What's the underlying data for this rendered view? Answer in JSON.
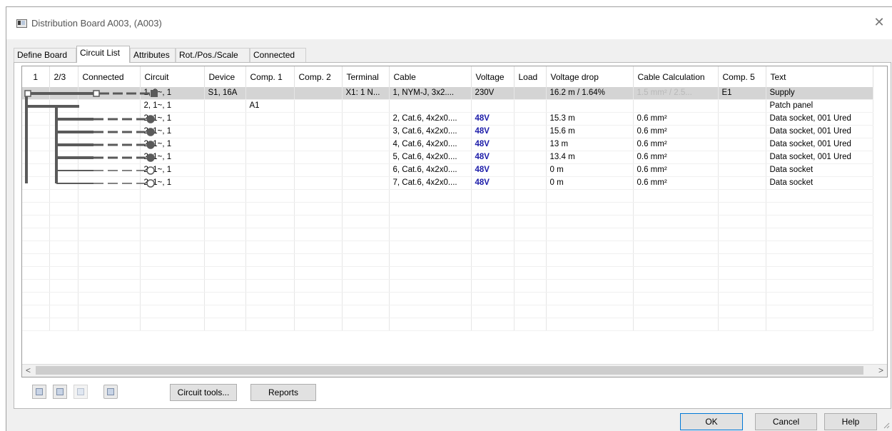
{
  "window": {
    "title": "Distribution Board A003,  (A003)",
    "close_label": "✕"
  },
  "tabs": [
    {
      "label": "Define Board",
      "active": false
    },
    {
      "label": "Circuit List",
      "active": true
    },
    {
      "label": "Attributes",
      "active": false
    },
    {
      "label": "Rot./Pos./Scale",
      "active": false
    },
    {
      "label": "Connected",
      "active": false
    }
  ],
  "grid": {
    "columns": [
      "1",
      "2/3",
      "Connected",
      "Circuit",
      "Device",
      "Comp. 1",
      "Comp. 2",
      "Terminal",
      "Cable",
      "Voltage",
      "Load",
      "Voltage drop",
      "Cable Calculation",
      "Comp. 5",
      "Text"
    ],
    "rows": [
      {
        "circuit": "1, 3~, 1",
        "device": "S1, 16A",
        "comp1": "",
        "comp2": "",
        "terminal": "X1: 1 N...",
        "cable": "1, NYM-J, 3x2....",
        "voltage": "230V",
        "load": "",
        "vdrop": "16.2 m / 1.64%",
        "cablecalc": "1.5 mm² / 2.5...",
        "comp5": "E1",
        "text": "Supply"
      },
      {
        "circuit": "2, 1~, 1",
        "device": "",
        "comp1": "A1",
        "comp2": "",
        "terminal": "",
        "cable": "",
        "voltage": "",
        "load": "",
        "vdrop": "",
        "cablecalc": "",
        "comp5": "",
        "text": "Patch panel"
      },
      {
        "circuit": "2, 1~, 1",
        "device": "",
        "comp1": "",
        "comp2": "",
        "terminal": "",
        "cable": "2, Cat.6, 4x2x0....",
        "voltage": "48V",
        "load": "",
        "vdrop": "15.3 m",
        "cablecalc": "0.6 mm²",
        "comp5": "",
        "text": "Data socket, 001 Ured"
      },
      {
        "circuit": "2, 1~, 1",
        "device": "",
        "comp1": "",
        "comp2": "",
        "terminal": "",
        "cable": "3, Cat.6, 4x2x0....",
        "voltage": "48V",
        "load": "",
        "vdrop": "15.6 m",
        "cablecalc": "0.6 mm²",
        "comp5": "",
        "text": "Data socket, 001 Ured"
      },
      {
        "circuit": "2, 1~, 1",
        "device": "",
        "comp1": "",
        "comp2": "",
        "terminal": "",
        "cable": "4, Cat.6, 4x2x0....",
        "voltage": "48V",
        "load": "",
        "vdrop": "13 m",
        "cablecalc": "0.6 mm²",
        "comp5": "",
        "text": "Data socket, 001 Ured"
      },
      {
        "circuit": "2, 1~, 1",
        "device": "",
        "comp1": "",
        "comp2": "",
        "terminal": "",
        "cable": "5, Cat.6, 4x2x0....",
        "voltage": "48V",
        "load": "",
        "vdrop": "13.4 m",
        "cablecalc": "0.6 mm²",
        "comp5": "",
        "text": "Data socket, 001 Ured"
      },
      {
        "circuit": "2, 1~, 1",
        "device": "",
        "comp1": "",
        "comp2": "",
        "terminal": "",
        "cable": "6, Cat.6, 4x2x0....",
        "voltage": "48V",
        "load": "",
        "vdrop": "0 m",
        "cablecalc": "0.6 mm²",
        "comp5": "",
        "text": "Data socket"
      },
      {
        "circuit": "2, 1~, 1",
        "device": "",
        "comp1": "",
        "comp2": "",
        "terminal": "",
        "cable": "7, Cat.6, 4x2x0....",
        "voltage": "48V",
        "load": "",
        "vdrop": "0 m",
        "cablecalc": "0.6 mm²",
        "comp5": "",
        "text": "Data socket"
      }
    ],
    "empty_rows": 11,
    "scroll_left": "<",
    "scroll_right": ">"
  },
  "toolbar": {
    "icons": [
      "circuit-add-icon",
      "circuit-edit-icon",
      "grid-icon",
      "target-icon"
    ],
    "circuit_tools_label": "Circuit tools...",
    "reports_label": "Reports"
  },
  "footer": {
    "ok_label": "OK",
    "cancel_label": "Cancel",
    "help_label": "Help"
  },
  "colors": {
    "selected_row": "#d4d4d4",
    "voltage_48": "#1a1aa8",
    "default_button_border": "#0078d7"
  }
}
